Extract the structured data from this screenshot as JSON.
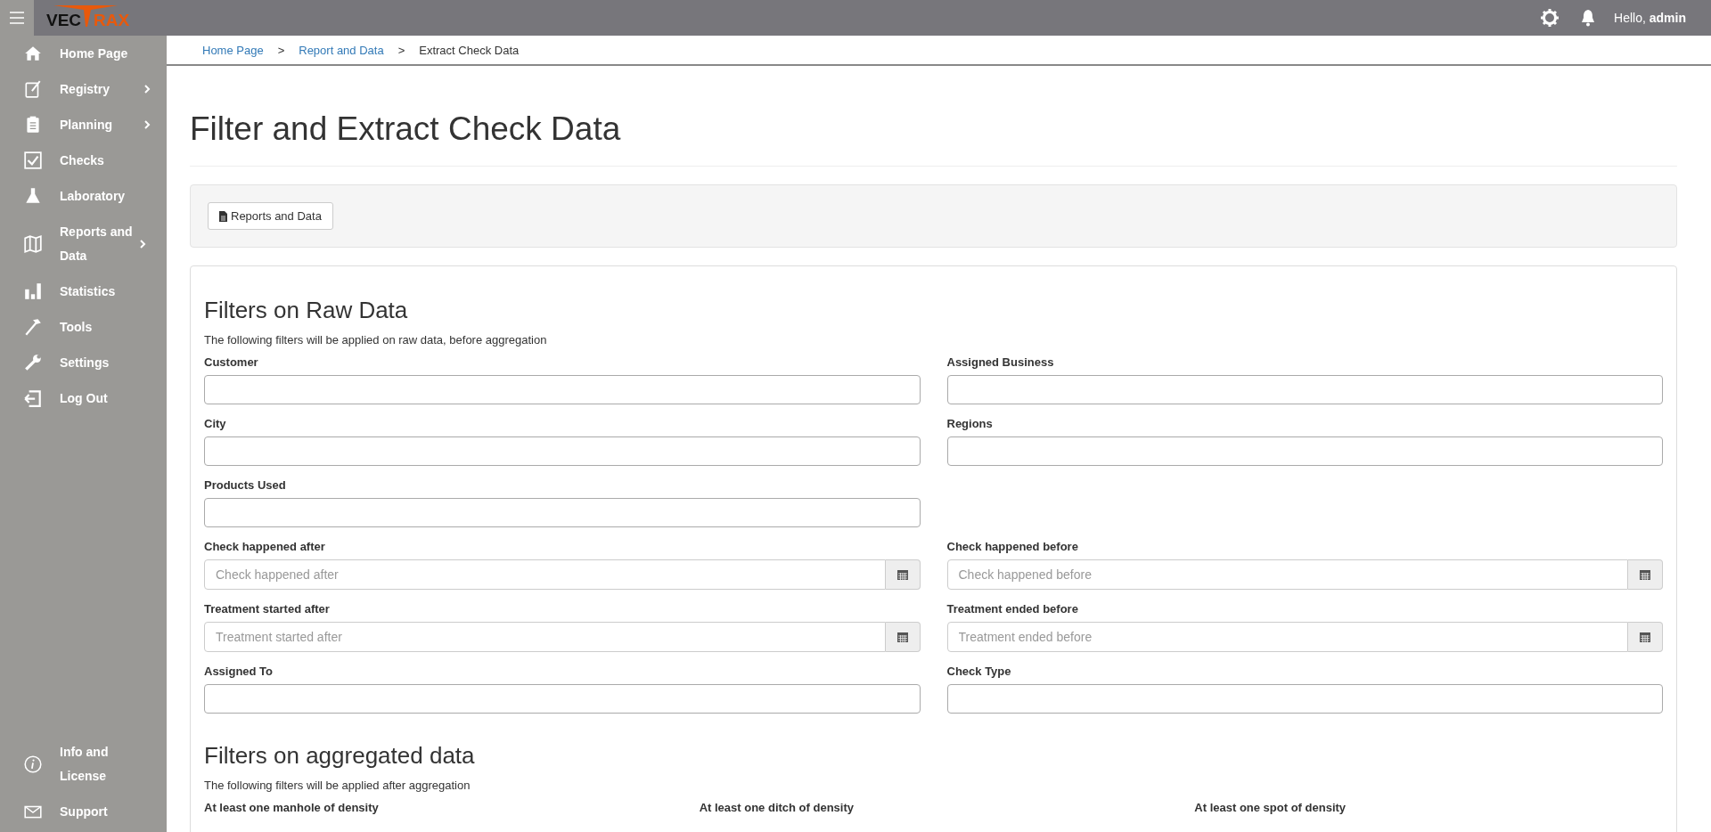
{
  "topbar": {
    "logo_left": "VEC",
    "logo_right": "RAX",
    "greeting": "Hello, ",
    "user": "admin"
  },
  "sidebar": {
    "items": [
      {
        "label": "Home Page",
        "expandable": false
      },
      {
        "label": "Registry",
        "expandable": true
      },
      {
        "label": "Planning",
        "expandable": true
      },
      {
        "label": "Checks",
        "expandable": false
      },
      {
        "label": "Laboratory",
        "expandable": false
      },
      {
        "label": "Reports and Data",
        "expandable": true
      },
      {
        "label": "Statistics",
        "expandable": false
      },
      {
        "label": "Tools",
        "expandable": false
      },
      {
        "label": "Settings",
        "expandable": false
      },
      {
        "label": "Log Out",
        "expandable": false
      }
    ],
    "bottom_items": [
      {
        "label": "Info and License"
      },
      {
        "label": "Support"
      }
    ]
  },
  "breadcrumb": [
    {
      "label": "Home Page",
      "kind": "link"
    },
    {
      "label": "Report and Data",
      "kind": "link"
    },
    {
      "label": "Extract Check Data",
      "kind": "current"
    }
  ],
  "breadcrumb_separator": ">",
  "page_title": "Filter and Extract Check Data",
  "toolbar": {
    "button": "Reports and Data"
  },
  "raw_filters": {
    "title": "Filters on Raw Data",
    "description": "The following filters will be applied on raw data, before aggregation",
    "rows": [
      [
        {
          "label": "Customer",
          "kind": "text"
        },
        {
          "label": "Assigned Business",
          "kind": "text"
        }
      ],
      [
        {
          "label": "City",
          "kind": "text"
        },
        {
          "label": "Regions",
          "kind": "text"
        }
      ],
      [
        {
          "label": "Products Used",
          "kind": "text"
        }
      ],
      [
        {
          "label": "Check happened after",
          "kind": "date",
          "placeholder": "Check happened after"
        },
        {
          "label": "Check happened before",
          "kind": "date",
          "placeholder": "Check happened before"
        }
      ],
      [
        {
          "label": "Treatment started after",
          "kind": "date",
          "placeholder": "Treatment started after"
        },
        {
          "label": "Treatment ended before",
          "kind": "date",
          "placeholder": "Treatment ended before"
        }
      ],
      [
        {
          "label": "Assigned To",
          "kind": "text"
        },
        {
          "label": "Check Type",
          "kind": "text"
        }
      ]
    ]
  },
  "aggregated_filters": {
    "title": "Filters on aggregated data",
    "description": "The following filters will be applied after aggregation",
    "labels": [
      "At least one manhole of density",
      "At least one ditch of density",
      "At least one spot of density"
    ]
  }
}
